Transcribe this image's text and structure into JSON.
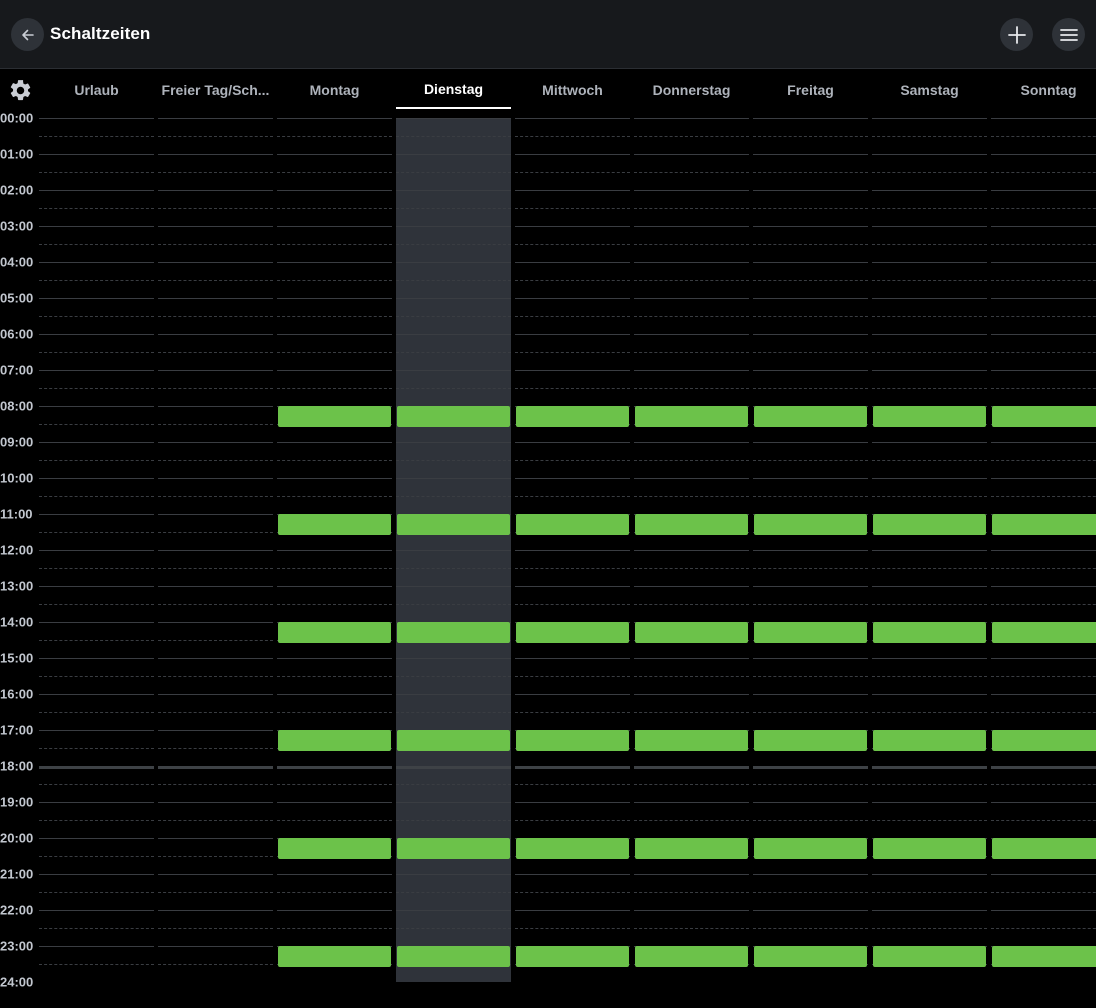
{
  "header": {
    "title": "Schaltzeiten",
    "back_icon": "arrow-left-icon",
    "add_icon": "plus-icon",
    "menu_icon": "hamburger-menu-icon"
  },
  "tabs": {
    "settings_icon": "gear-icon",
    "items": [
      "Urlaub",
      "Freier Tag/Sch...",
      "Montag",
      "Dienstag",
      "Mittwoch",
      "Donnerstag",
      "Freitag",
      "Samstag",
      "Sonntag"
    ],
    "active": "Dienstag"
  },
  "hours": [
    "00:00",
    "01:00",
    "02:00",
    "03:00",
    "04:00",
    "05:00",
    "06:00",
    "07:00",
    "08:00",
    "09:00",
    "10:00",
    "11:00",
    "12:00",
    "13:00",
    "14:00",
    "15:00",
    "16:00",
    "17:00",
    "18:00",
    "19:00",
    "20:00",
    "21:00",
    "22:00",
    "23:00",
    "24:00"
  ],
  "current_time_marker": "18:00",
  "schedule": {
    "Urlaub": [],
    "Freier Tag/Sch...": [],
    "Montag": [
      [
        8.0,
        8.5
      ],
      [
        11.0,
        11.5
      ],
      [
        14.0,
        14.5
      ],
      [
        17.0,
        17.5
      ],
      [
        20.0,
        20.5
      ],
      [
        23.0,
        23.5
      ]
    ],
    "Dienstag": [
      [
        8.0,
        8.5
      ],
      [
        11.0,
        11.5
      ],
      [
        14.0,
        14.5
      ],
      [
        17.0,
        17.5
      ],
      [
        20.0,
        20.5
      ],
      [
        23.0,
        23.5
      ]
    ],
    "Mittwoch": [
      [
        8.0,
        8.5
      ],
      [
        11.0,
        11.5
      ],
      [
        14.0,
        14.5
      ],
      [
        17.0,
        17.5
      ],
      [
        20.0,
        20.5
      ],
      [
        23.0,
        23.5
      ]
    ],
    "Donnerstag": [
      [
        8.0,
        8.5
      ],
      [
        11.0,
        11.5
      ],
      [
        14.0,
        14.5
      ],
      [
        17.0,
        17.5
      ],
      [
        20.0,
        20.5
      ],
      [
        23.0,
        23.5
      ]
    ],
    "Freitag": [
      [
        8.0,
        8.5
      ],
      [
        11.0,
        11.5
      ],
      [
        14.0,
        14.5
      ],
      [
        17.0,
        17.5
      ],
      [
        20.0,
        20.5
      ],
      [
        23.0,
        23.5
      ]
    ],
    "Samstag": [
      [
        8.0,
        8.5
      ],
      [
        11.0,
        11.5
      ],
      [
        14.0,
        14.5
      ],
      [
        17.0,
        17.5
      ],
      [
        20.0,
        20.5
      ],
      [
        23.0,
        23.5
      ]
    ],
    "Sonntag": [
      [
        8.0,
        8.5
      ],
      [
        11.0,
        11.5
      ],
      [
        14.0,
        14.5
      ],
      [
        17.0,
        17.5
      ],
      [
        20.0,
        20.5
      ],
      [
        23.0,
        23.5
      ]
    ]
  },
  "colors": {
    "event": "#6cc24a",
    "highlight_column": "#2f333a",
    "background": "#000000",
    "header": "#17191c"
  }
}
